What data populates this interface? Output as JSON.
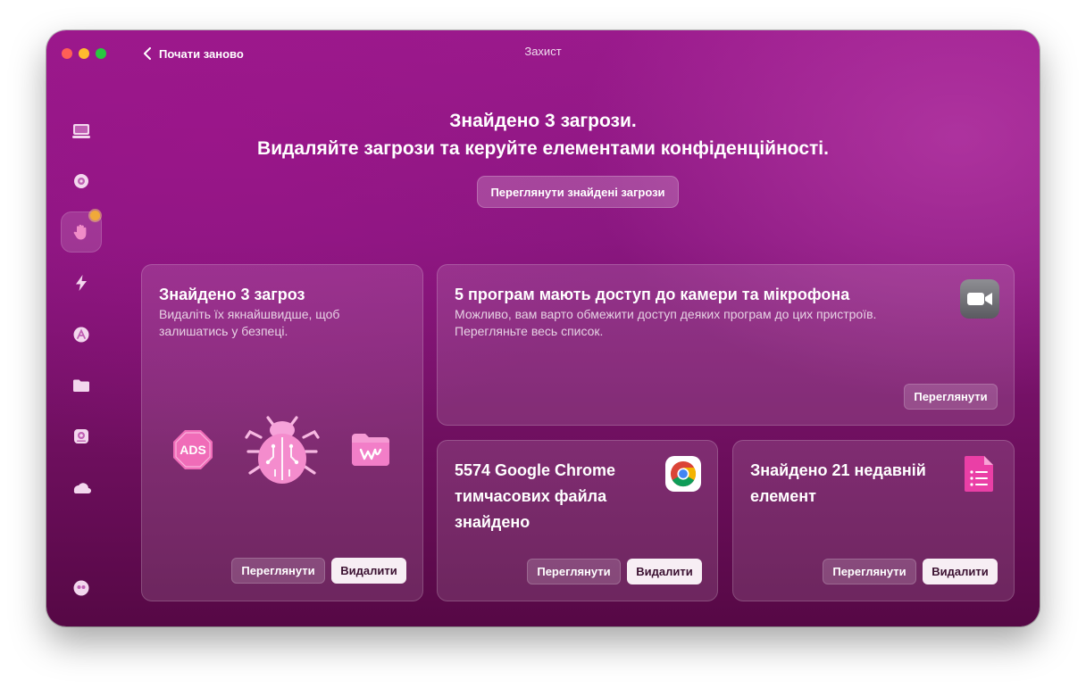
{
  "window": {
    "title": "Захист",
    "back_label": "Почати заново"
  },
  "sidebar": {
    "items": [
      {
        "name": "sidebar-item-cleanup",
        "icon": "monitor-icon"
      },
      {
        "name": "sidebar-item-protection-scan",
        "icon": "virus-icon"
      },
      {
        "name": "sidebar-item-protection",
        "icon": "hand-icon",
        "active": true,
        "has_badge": true
      },
      {
        "name": "sidebar-item-speed",
        "icon": "lightning-icon"
      },
      {
        "name": "sidebar-item-applications",
        "icon": "apps-icon"
      },
      {
        "name": "sidebar-item-files",
        "icon": "folder-icon"
      },
      {
        "name": "sidebar-item-space-lens",
        "icon": "disk-icon"
      },
      {
        "name": "sidebar-item-cloud",
        "icon": "cloud-icon"
      },
      {
        "name": "sidebar-item-assistant",
        "icon": "assistant-icon"
      }
    ]
  },
  "header": {
    "line1": "Знайдено 3 загрози.",
    "line2": "Видаляйте загрози та керуйте елементами конфіденційності.",
    "view_button": "Переглянути знайдені загрози"
  },
  "cards": {
    "threats": {
      "title": "Знайдено 3 загроз",
      "desc_line1": "Видаліть їх якнайшвидше, щоб",
      "desc_line2": "залишатись у безпеці.",
      "ads_label": "ADS",
      "review": "Переглянути",
      "remove": "Видалити"
    },
    "camera": {
      "title": "5 програм мають доступ до камери та мікрофона",
      "desc_line1": "Можливо, вам варто обмежити доступ деяких програм до цих пристроїв.",
      "desc_line2": "Перегляньте весь список.",
      "review": "Переглянути"
    },
    "chrome": {
      "title_line1": "5574 Google Chrome",
      "title_line2": "тимчасових файла",
      "title_line3": "знайдено",
      "review": "Переглянути",
      "remove": "Видалити"
    },
    "recent": {
      "title_line1": "Знайдено 21 недавній",
      "title_line2": "елемент",
      "review": "Переглянути",
      "remove": "Видалити"
    }
  },
  "colors": {
    "accent_badge": "#f0a93a",
    "button_solid": "#f7eef4"
  }
}
